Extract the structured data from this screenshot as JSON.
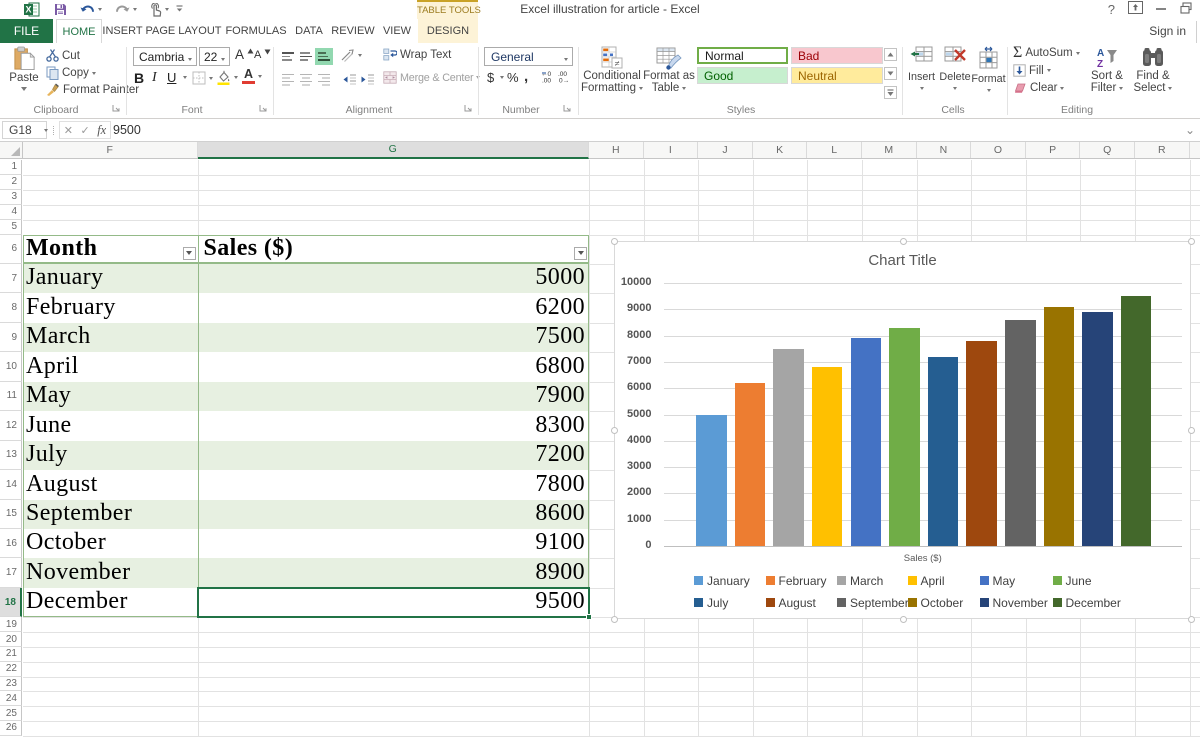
{
  "window": {
    "title": "Excel illustration for article - Excel",
    "help_label": "?",
    "sign_in": "Sign in"
  },
  "tabs": {
    "file": "FILE",
    "items": [
      "HOME",
      "INSERT",
      "PAGE LAYOUT",
      "FORMULAS",
      "DATA",
      "REVIEW",
      "VIEW"
    ],
    "active": "HOME",
    "contextual_group": "TABLE TOOLS",
    "contextual_tab": "DESIGN"
  },
  "ribbon": {
    "clipboard": {
      "label": "Clipboard",
      "paste": "Paste",
      "cut": "Cut",
      "copy": "Copy",
      "format_painter": "Format Painter"
    },
    "font": {
      "label": "Font",
      "font_name": "Cambria",
      "font_size": "22",
      "bold": "B",
      "italic": "I",
      "underline": "U"
    },
    "alignment": {
      "label": "Alignment",
      "wrap_text": "Wrap Text",
      "merge_center": "Merge & Center"
    },
    "number": {
      "label": "Number",
      "format": "General",
      "currency": "$",
      "percent": "%",
      "comma": ",",
      "inc_dec": ".0",
      "dec_dec": ".00"
    },
    "styles": {
      "label": "Styles",
      "conditional_line1": "Conditional",
      "conditional_line2": "Formatting",
      "format_table_line1": "Format as",
      "format_table_line2": "Table",
      "gallery": [
        {
          "label": "Normal",
          "bg": "#ffffff",
          "fg": "#1a1a1a",
          "selected": true
        },
        {
          "label": "Bad",
          "bg": "#f8c7ce",
          "fg": "#9c0006",
          "selected": false
        },
        {
          "label": "Good",
          "bg": "#c6efce",
          "fg": "#006100",
          "selected": false
        },
        {
          "label": "Neutral",
          "bg": "#ffeb9c",
          "fg": "#9c6500",
          "selected": false
        }
      ]
    },
    "cells": {
      "label": "Cells",
      "items": [
        "Insert",
        "Delete",
        "Format"
      ]
    },
    "editing": {
      "label": "Editing",
      "autosum": "AutoSum",
      "fill": "Fill",
      "clear": "Clear",
      "sort_line1": "Sort &",
      "sort_line2": "Filter",
      "find_line1": "Find &",
      "find_line2": "Select"
    }
  },
  "formula_bar": {
    "name_box": "G18",
    "fx": "fx",
    "value": "9500"
  },
  "sheet": {
    "column_letters": [
      "F",
      "G",
      "H",
      "I",
      "J",
      "K",
      "L",
      "M",
      "N",
      "O",
      "P",
      "Q",
      "R"
    ],
    "selected_column": "G",
    "row_numbers": [
      1,
      2,
      3,
      4,
      5,
      6,
      7,
      8,
      9,
      10,
      11,
      12,
      13,
      14,
      15,
      16,
      17,
      18,
      19,
      20,
      21,
      22,
      23,
      24,
      25,
      26
    ],
    "selected_row": 18
  },
  "table": {
    "headers": [
      "Month",
      "Sales ($)"
    ],
    "rows": [
      [
        "January",
        "5000"
      ],
      [
        "February",
        "6200"
      ],
      [
        "March",
        "7500"
      ],
      [
        "April",
        "6800"
      ],
      [
        "May",
        "7900"
      ],
      [
        "June",
        "8300"
      ],
      [
        "July",
        "7200"
      ],
      [
        "August",
        "7800"
      ],
      [
        "September",
        "8600"
      ],
      [
        "October",
        "9100"
      ],
      [
        "November",
        "8900"
      ],
      [
        "December",
        "9500"
      ]
    ],
    "band_color": "#e7f0e1",
    "border_color": "#94ba88",
    "selection_color": "#217346"
  },
  "chart_data": {
    "type": "bar",
    "title": "Chart Title",
    "categories": [
      "January",
      "February",
      "March",
      "April",
      "May",
      "June",
      "July",
      "August",
      "September",
      "October",
      "November",
      "December"
    ],
    "values": [
      5000,
      6200,
      7500,
      6800,
      7900,
      8300,
      7200,
      7800,
      8600,
      9100,
      8900,
      9500
    ],
    "colors": [
      "#5b9bd5",
      "#ed7d31",
      "#a5a5a5",
      "#ffc000",
      "#4472c4",
      "#70ad47",
      "#255e91",
      "#9e480e",
      "#636363",
      "#997300",
      "#264478",
      "#43682b"
    ],
    "xlabel": "Sales ($)",
    "ylabel": "",
    "ylim": [
      0,
      10000
    ],
    "ytick_step": 1000,
    "grid": true,
    "legend_position": "bottom"
  }
}
